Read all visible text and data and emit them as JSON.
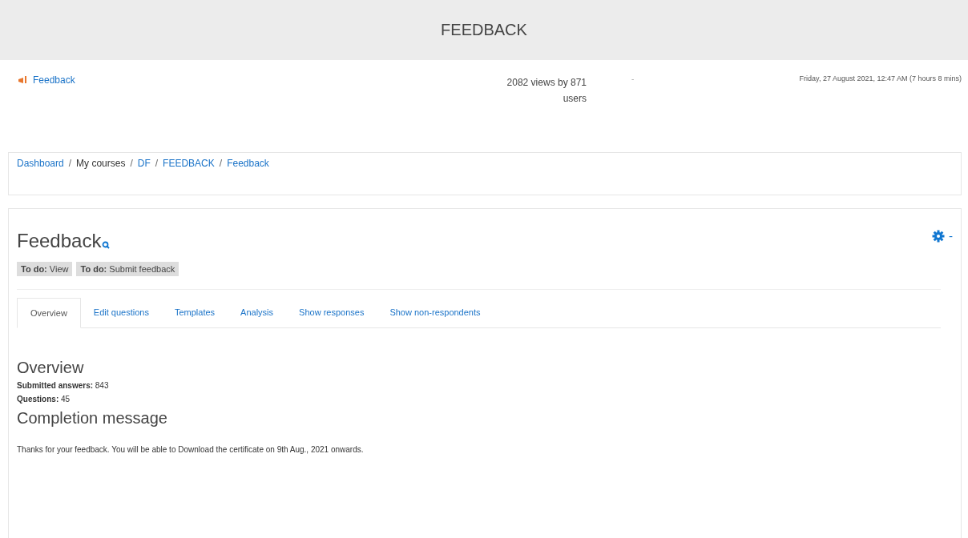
{
  "header": {
    "title": "FEEDBACK"
  },
  "info": {
    "link": "Feedback",
    "views": "2082 views by 871 users",
    "separator": "-",
    "date": "Friday, 27 August 2021, 12:47 AM (7 hours 8 mins)"
  },
  "breadcrumb": [
    {
      "label": "Dashboard",
      "kind": "link"
    },
    {
      "label": "My courses",
      "kind": "text"
    },
    {
      "label": "DF",
      "kind": "link"
    },
    {
      "label": "FEEDBACK",
      "kind": "link"
    },
    {
      "label": "Feedback",
      "kind": "link"
    }
  ],
  "breadcrumb_separator": "/",
  "page": {
    "title": "Feedback",
    "dropdown_caret": "-",
    "todos": [
      "**To do:** View",
      "**To do:** Submit feedback"
    ],
    "tabs": [
      {
        "label": "Overview",
        "selected": true
      },
      {
        "label": "Edit questions",
        "selected": false
      },
      {
        "label": "Templates",
        "selected": false
      },
      {
        "label": "Analysis",
        "selected": false
      },
      {
        "label": "Show responses",
        "selected": false
      },
      {
        "label": "Show non-respondents",
        "selected": false
      }
    ],
    "overview_heading": "Overview",
    "stats": [
      "**Submitted answers:** 843",
      "**Questions:** 45"
    ],
    "completion_heading": "Completion message",
    "completion_text": "Thanks for your feedback. You will be able to Download the certificate on 9th Aug., 2021 onwards."
  }
}
